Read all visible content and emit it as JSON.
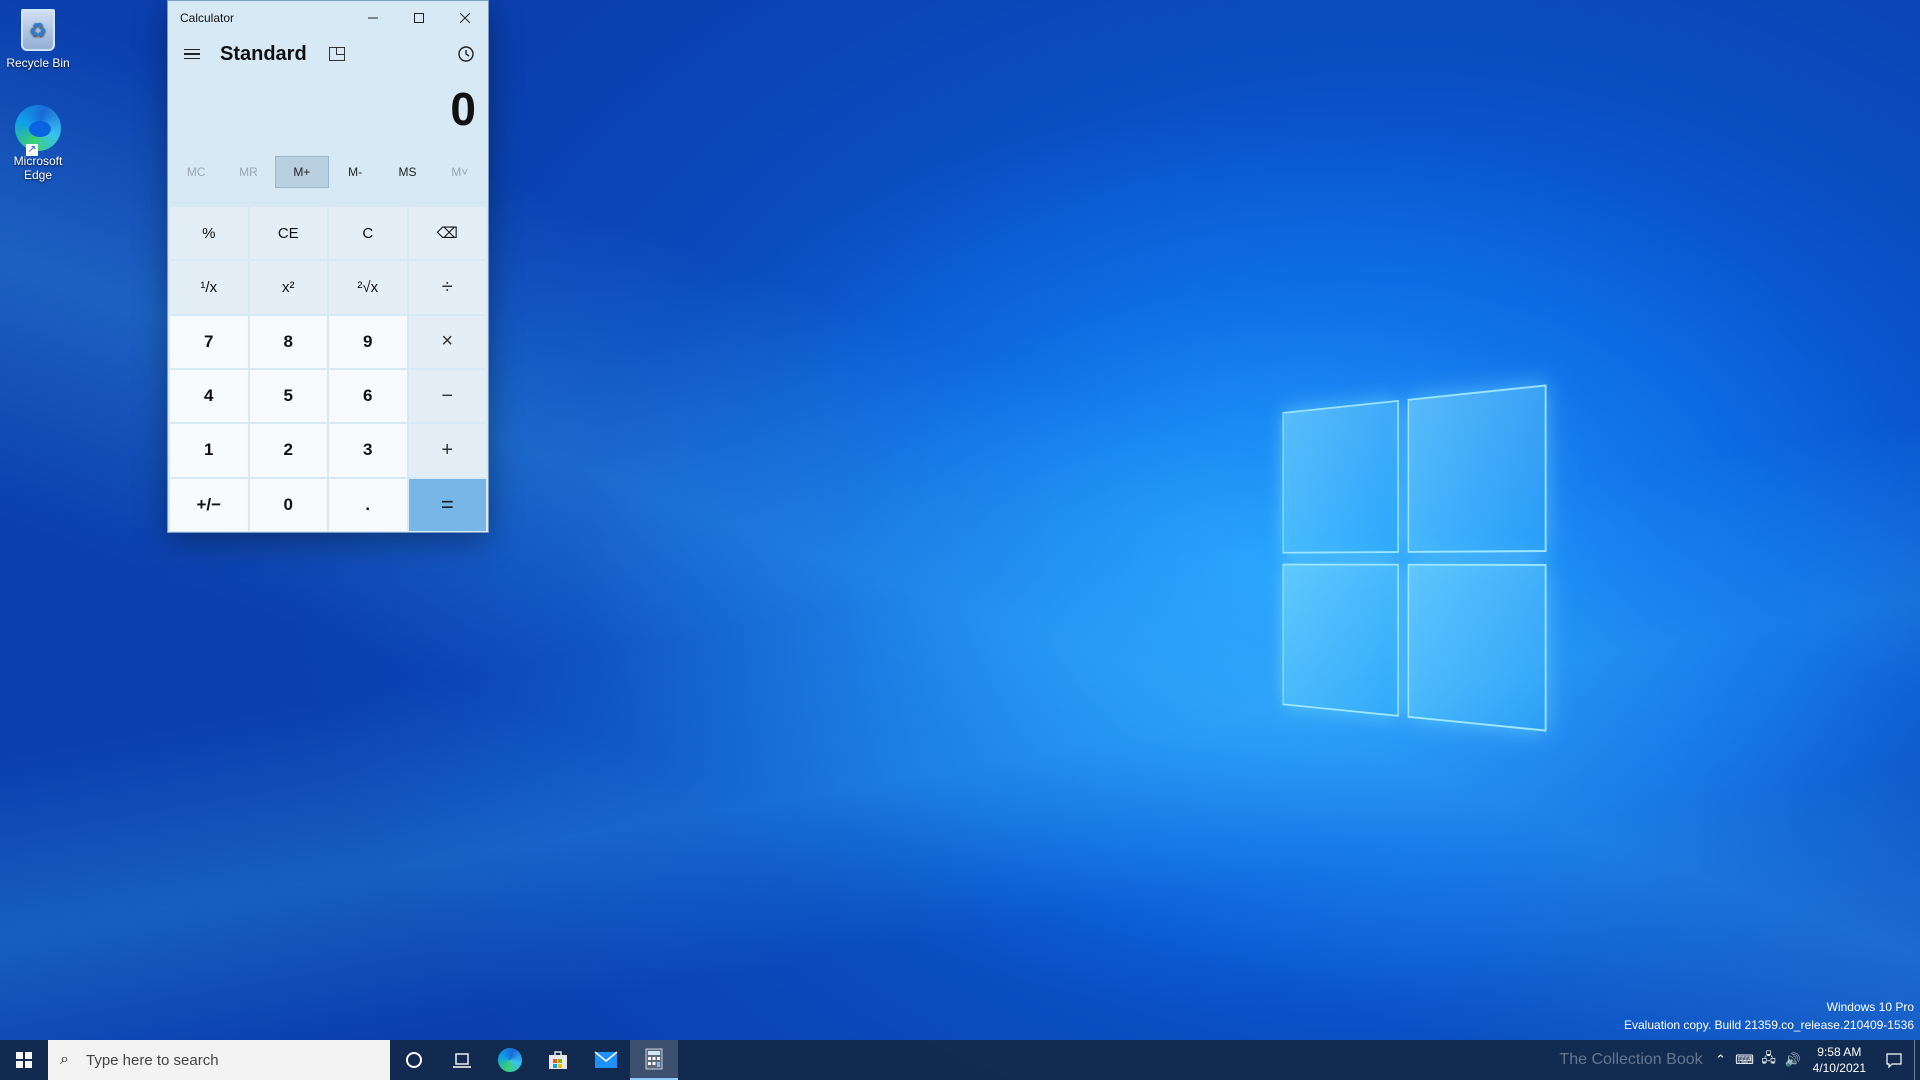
{
  "desktop": {
    "icons": [
      {
        "label": "Recycle Bin"
      },
      {
        "label": "Microsoft Edge"
      }
    ],
    "watermark": {
      "line1": "Windows 10 Pro",
      "line2": "Evaluation copy. Build 21359.co_release.210409-1536"
    }
  },
  "calculator": {
    "window_title": "Calculator",
    "mode": "Standard",
    "display_value": "0",
    "memory_buttons": [
      "MC",
      "MR",
      "M+",
      "M-",
      "MS",
      "M˅"
    ],
    "keys": [
      "%",
      "CE",
      "C",
      "⌫",
      "¹/x",
      "x²",
      "²√x",
      "÷",
      "7",
      "8",
      "9",
      "×",
      "4",
      "5",
      "6",
      "−",
      "1",
      "2",
      "3",
      "+",
      "+/−",
      "0",
      ".",
      "="
    ]
  },
  "taskbar": {
    "search_placeholder": "Type here to search",
    "time": "9:58 AM",
    "date": "4/10/2021",
    "tray_overlay_text": "The Collection Book"
  },
  "colors": {
    "calc_bg": "#d7e9f5",
    "equals_key": "#77b6e6",
    "taskbar": "#14284a"
  }
}
